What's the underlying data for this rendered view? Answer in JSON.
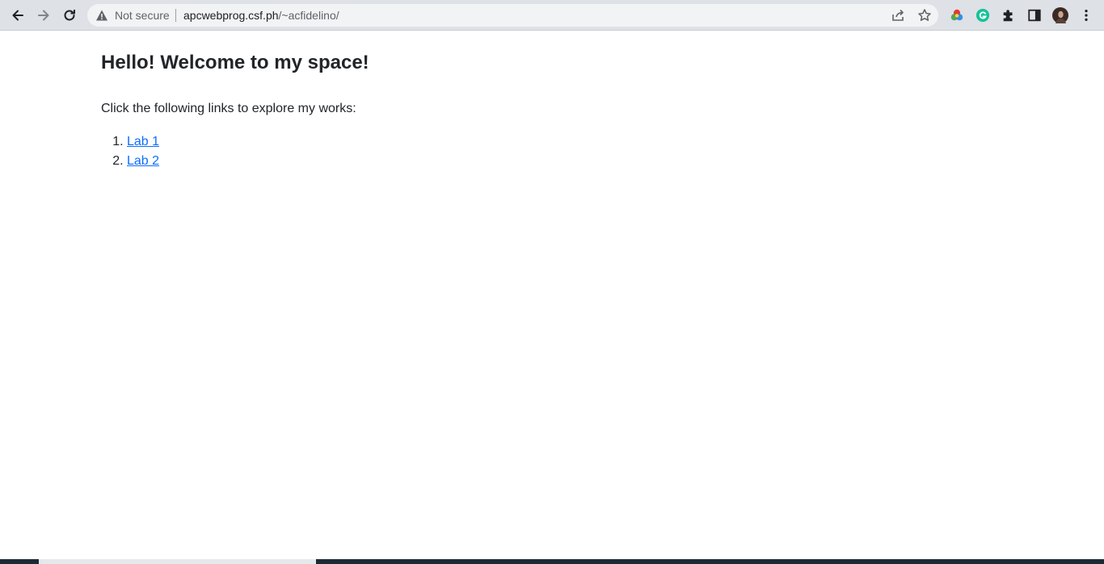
{
  "browser": {
    "security_label": "Not secure",
    "url_host": "apcwebprog.csf.ph",
    "url_path": "/~acfidelino/",
    "icons": [
      "back-icon",
      "forward-icon",
      "reload-icon",
      "warning-icon",
      "share-icon",
      "bookmark-star-icon",
      "color-extension-icon",
      "grammarly-icon",
      "extensions-puzzle-icon",
      "side-panel-icon",
      "profile-avatar",
      "menu-kebab-icon"
    ]
  },
  "page": {
    "heading": "Hello! Welcome to my space!",
    "intro": "Click the following links to explore my works:",
    "links": [
      {
        "label": "Lab 1"
      },
      {
        "label": "Lab 2"
      }
    ]
  },
  "colors": {
    "link": "#0d6efd",
    "text": "#212529",
    "toolbar": "#dee1e6",
    "omnibox": "#f1f3f4"
  }
}
